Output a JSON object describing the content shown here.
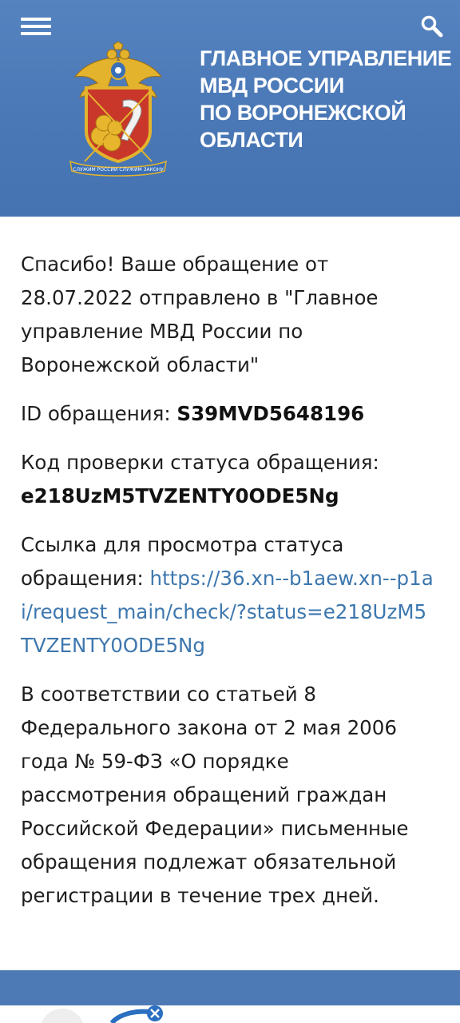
{
  "header": {
    "org_title_lines": [
      "ГЛАВНОЕ УПРАВЛЕНИЕ",
      "МВД РОССИИ",
      "ПО ВОРОНЕЖСКОЙ",
      "ОБЛАСТИ"
    ],
    "emblem_text": "СЛУЖИМ РОССИИ СЛУЖИМ ЗАКОНУ",
    "menu_icon": "hamburger-menu-icon",
    "search_icon": "search-icon",
    "color": "#4a78b6"
  },
  "message": {
    "confirmation": "Спасибо! Ваше обращение от 28.07.2022 отправлено в \"Главное управление МВД России по Воронежской области\"",
    "id_label": "ID обращения: ",
    "id_value": "S39MVD5648196",
    "status_code_label": "Код проверки статуса обращения: ",
    "status_code_value": "e218UzM5TVZENTY0ODE5Ng",
    "link_label": "Ссылка для просмотра статуса обращения: ",
    "link_url": "https://36.xn--b1aew.xn--p1ai/request_main/check/?status=e218UzM5TVZENTY0ODE5Ng",
    "legal_notice": "В соответствии со статьей 8 Федерального закона от 2 мая 2006 года № 59-ФЗ «О порядке рассмотрения обращений граждан Российской Федерации» письменные обращения подлежат обязательной регистрации в течение трех дней."
  },
  "colors": {
    "link": "#3d77ae",
    "footer": "#4d79b4"
  }
}
